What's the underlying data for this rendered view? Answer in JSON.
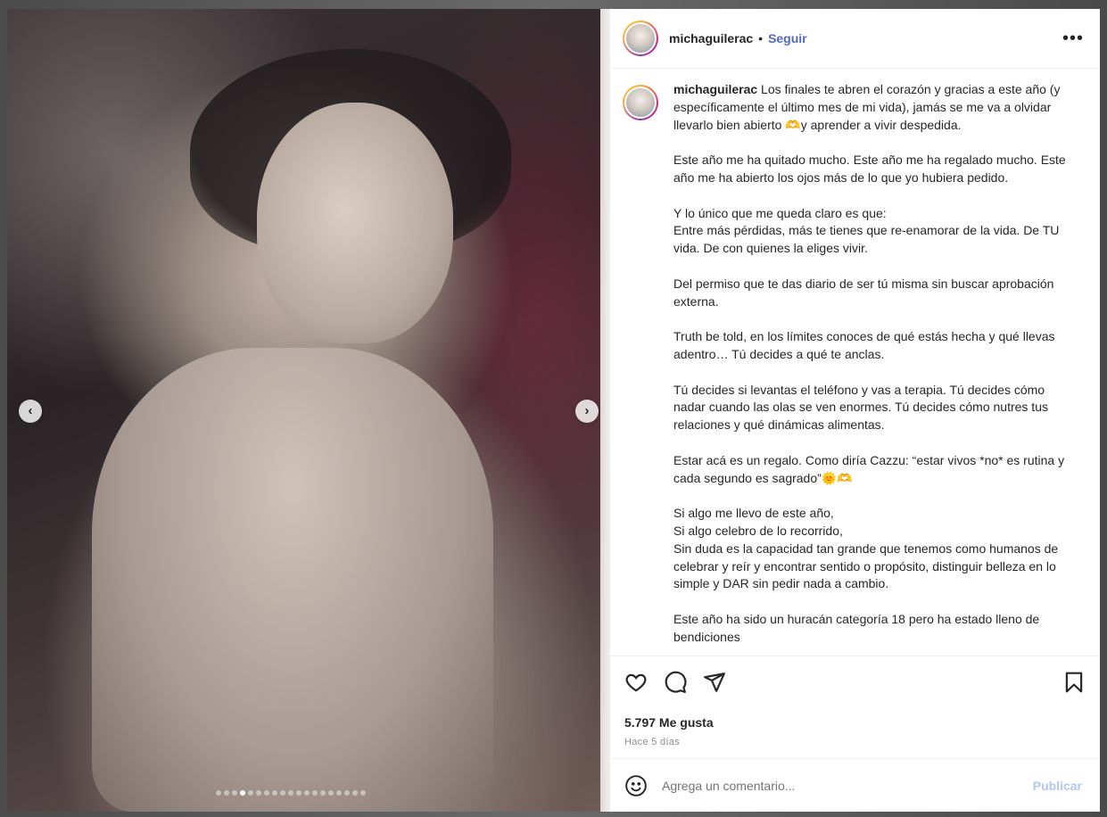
{
  "post": {
    "username": "michaguilerac",
    "follow_label": "Seguir",
    "separator": "•",
    "more_label": "•••",
    "carousel": {
      "total": 19,
      "active": 3
    },
    "caption": {
      "username": "michaguilerac",
      "paragraphs": [
        "Los finales te abren el corazón y gracias a este año (y específicamente el último mes de mi vida), jamás se me va a olvidar llevarlo bien abierto 🫶y aprender a vivir despedida.",
        "Este año me ha quitado mucho. Este año me ha regalado mucho. Este año me ha abierto los ojos más de lo que yo hubiera pedido.",
        "Y lo único que me queda claro es que:\nEntre más pérdidas, más te tienes que re-enamorar de la vida. De TU vida. De con quienes la eliges vivir.",
        "Del permiso que te das diario de ser tú misma sin buscar aprobación externa.",
        "Truth be told, en los límites conoces de qué estás hecha y qué llevas adentro… Tú decides a qué te anclas.",
        "Tú decides si levantas el teléfono y vas a terapia. Tú decides cómo nadar cuando las olas se ven enormes. Tú decides cómo nutres tus relaciones y qué dinámicas alimentas.",
        "Estar acá es un regalo. Como diría Cazzu: “estar vivos *no* es rutina y cada segundo es sagrado”🌞🫶",
        "Si algo me llevo de este año,\nSi algo celebro de lo recorrido,\nSin duda es la capacidad tan grande que tenemos como humanos de celebrar y reír y encontrar sentido o propósito, distinguir belleza en lo simple y DAR sin pedir nada a cambio.",
        "Este año ha sido un huracán categoría 18 pero ha estado lleno de bendiciones"
      ]
    },
    "likes": "5.797 Me gusta",
    "time": "Hace 5 días",
    "comment_placeholder": "Agrega un comentario...",
    "publish_label": "Publicar"
  }
}
